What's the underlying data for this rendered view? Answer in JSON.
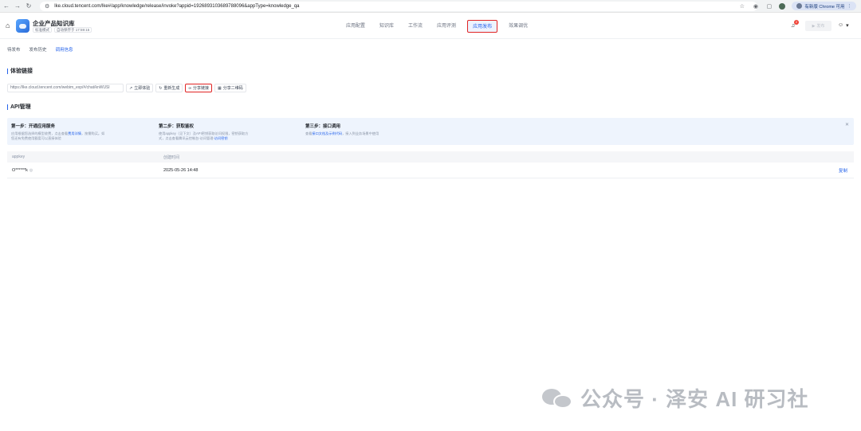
{
  "browser": {
    "url": "lke.cloud.tencent.com/lke#/app/knowledge/release/invoke?appid=1926893103689788096&appType=knowledge_qa",
    "update_label": "有新版 Chrome 可用"
  },
  "app": {
    "name": "企业产品知识库",
    "tags": [
      "标准模式",
      "自动保存于 17:59:15"
    ]
  },
  "top_nav": [
    "应用配置",
    "知识库",
    "工作流",
    "应用评测",
    "应用发布",
    "效果调优"
  ],
  "top_nav_active": "应用发布",
  "notifications": {
    "count": "2"
  },
  "publish_button": "发布",
  "sub_tabs": [
    "待发布",
    "发布历史",
    "调用信息"
  ],
  "sub_tab_active": "调用信息",
  "experience": {
    "title": "体验链接",
    "url": "https://lke.cloud.tencent.com/webim_exp/#/chat/knWUSl",
    "buttons": {
      "open": "立即体验",
      "regenerate": "重新生成",
      "share_link": "分享链接",
      "share_qr": "分享二维码"
    }
  },
  "api": {
    "title": "API管理",
    "steps": [
      {
        "title": "第一步：开通应用服务",
        "desc_pre": "应用根据您选择的模型收费，点击查看",
        "link": "费用详情",
        "desc_post": "，按需购买。如您还有免费使用额度可以直接体验"
      },
      {
        "title": "第二步：获取鉴权",
        "desc_pre": "使用appkey（见下文）及API密钥获取访问权限，密钥获取方式，点击查看腾讯云控制台-访问管理-",
        "link": "访问密钥",
        "desc_post": ""
      },
      {
        "title": "第三步：接口调用",
        "desc_pre": "查看",
        "link": "接口文档及示例代码",
        "desc_post": "，接入到业务场景中使用"
      }
    ],
    "table": {
      "headers": [
        "appkey",
        "创建时间",
        ""
      ],
      "rows": [
        {
          "appkey": "O******k",
          "created": "2025-05-26 14:48",
          "action": "复制"
        }
      ]
    }
  },
  "watermark": "公众号 · 泽安 AI 研习社"
}
